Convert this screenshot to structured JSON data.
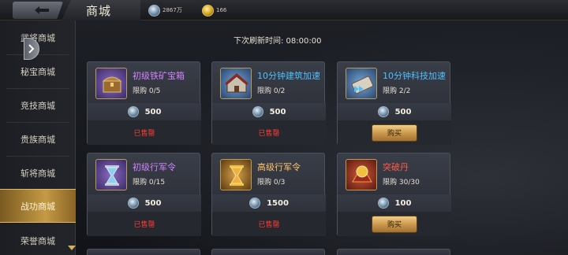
{
  "header": {
    "title": "商城",
    "silver_value": "2867万",
    "gold_value": "166"
  },
  "sidebar": {
    "items": [
      {
        "label": "武将商城"
      },
      {
        "label": "秘宝商城"
      },
      {
        "label": "竞技商城"
      },
      {
        "label": "贵族商城"
      },
      {
        "label": "斩将商城"
      },
      {
        "label": "战功商城"
      },
      {
        "label": "荣誉商城"
      }
    ],
    "active_index": 5
  },
  "main": {
    "refresh_text": "下次刷新时间:  08:00:00",
    "cards": [
      {
        "name": "初级铁矿宝箱",
        "name_color": "purple",
        "icon": "treasure-chest-icon",
        "limit_text": "限购 0/5",
        "price": "500",
        "status": "已售罄",
        "buy_label": ""
      },
      {
        "name": "10分钟建筑加速",
        "name_color": "blue",
        "icon": "building-speedup-icon",
        "limit_text": "限购 0/2",
        "price": "500",
        "status": "已售罄",
        "buy_label": ""
      },
      {
        "name": "10分钟科技加速",
        "name_color": "blue",
        "icon": "tech-speedup-icon",
        "limit_text": "限购 2/2",
        "price": "500",
        "status": "",
        "buy_label": "购买"
      },
      {
        "name": "初级行军令",
        "name_color": "purple",
        "icon": "hourglass-icon",
        "limit_text": "限购 0/15",
        "price": "500",
        "status": "已售罄",
        "buy_label": ""
      },
      {
        "name": "高级行军令",
        "name_color": "orange",
        "icon": "gold-hourglass-icon",
        "limit_text": "限购 0/3",
        "price": "1500",
        "status": "已售罄",
        "buy_label": ""
      },
      {
        "name": "突破丹",
        "name_color": "red",
        "icon": "breakthrough-pill-icon",
        "limit_text": "限购 30/30",
        "price": "100",
        "status": "",
        "buy_label": "购买"
      }
    ]
  },
  "colors": {
    "sold_out": "#ff3b30",
    "accent_gold": "#c49a44"
  }
}
